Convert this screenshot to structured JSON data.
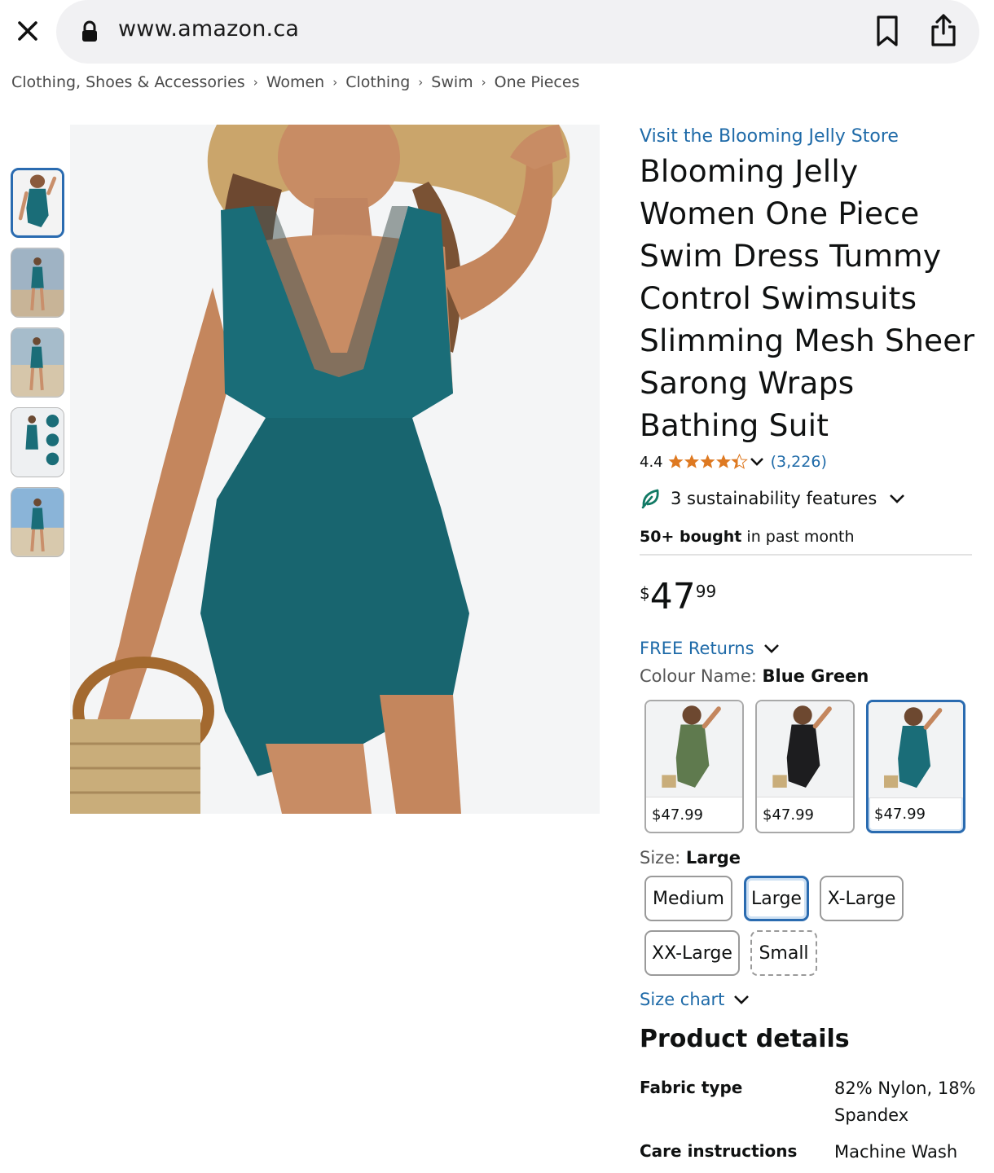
{
  "browser": {
    "url": "www.amazon.ca"
  },
  "breadcrumb": [
    "Clothing, Shoes & Accessories",
    "Women",
    "Clothing",
    "Swim",
    "One Pieces"
  ],
  "product": {
    "store_link": "Visit the Blooming Jelly Store",
    "title": "Blooming Jelly Women One Piece Swim Dress Tummy Control Swimsuits Slimming Mesh Sheer Sarong Wraps Bathing Suit",
    "rating": "4.4",
    "rating_stars": 4.4,
    "review_count": "(3,226)",
    "sustainability": "3 sustainability features",
    "bought_bold": "50+ bought",
    "bought_rest": " in past month",
    "price_symbol": "$",
    "price_whole": "47",
    "price_fraction": "99",
    "returns": "FREE Returns",
    "colour_label": "Colour Name: ",
    "colour_value": "Blue Green",
    "colours": [
      {
        "name": "green",
        "price": "$47.99",
        "color": "#5f7a4e"
      },
      {
        "name": "black",
        "price": "$47.99",
        "color": "#1d1d1f"
      },
      {
        "name": "blue-green",
        "price": "$47.99",
        "color": "#1a6d78"
      }
    ],
    "size_label": "Size: ",
    "size_value": "Large",
    "sizes": [
      "Medium",
      "Large",
      "X-Large",
      "XX-Large",
      "Small"
    ],
    "size_chart": "Size chart"
  },
  "details": {
    "heading": "Product details",
    "rows": [
      {
        "label": "Fabric type",
        "value": "82% Nylon, 18% Spandex"
      },
      {
        "label": "Care instructions",
        "value": "Machine Wash"
      }
    ]
  },
  "colors": {
    "link": "#1e6aa8",
    "star": "#de7921",
    "swimsuit": "#1a6d78",
    "selected_border": "#2a6bb0"
  }
}
